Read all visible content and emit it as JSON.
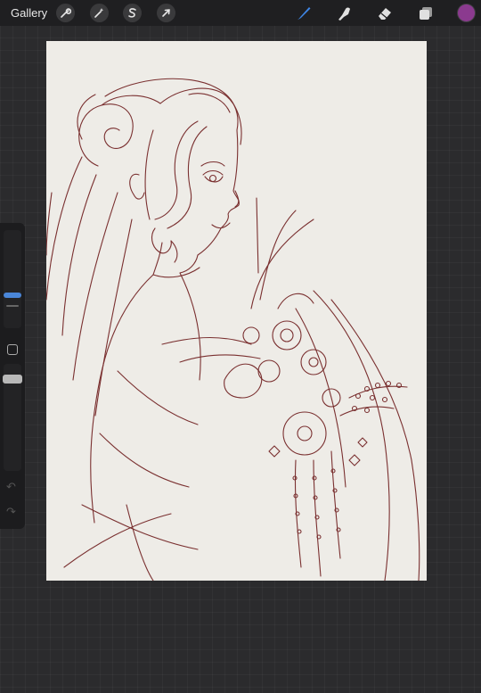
{
  "toolbar": {
    "gallery_label": "Gallery",
    "actions_icon": "wrench-icon",
    "adjustments_icon": "magic-wand-icon",
    "selection_icon": "selection-s-icon",
    "transform_icon": "arrow-cursor-icon",
    "brush_icon": "brush-icon",
    "smudge_icon": "smudge-finger-icon",
    "eraser_icon": "eraser-icon",
    "layers_icon": "layers-icon",
    "active_tool": "brush",
    "active_tool_color": "#3f86e6",
    "current_color": "#8b3a8f"
  },
  "sidebar": {
    "brush_size_level": 0.42,
    "undo_icon": "undo-icon",
    "redo_icon": "redo-icon",
    "undo_glyph": "↶",
    "redo_glyph": "↷"
  },
  "canvas": {
    "paper_color": "#eeece7",
    "line_color": "#7a3030"
  }
}
